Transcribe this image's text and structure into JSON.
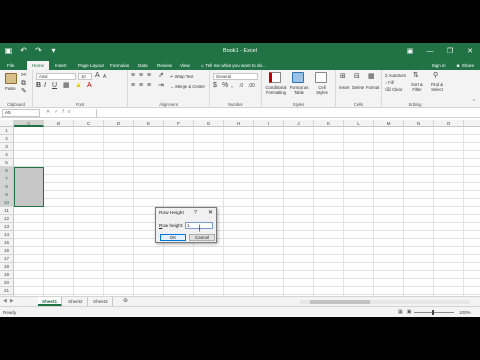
{
  "window": {
    "title": "Book1 - Excel",
    "qat_icons": [
      "save-icon",
      "undo-icon",
      "redo-icon",
      "customize-icon"
    ],
    "controls": [
      "minimize-icon",
      "restore-icon",
      "close-icon"
    ]
  },
  "ribbon_tabs": [
    "File",
    "Home",
    "Insert",
    "Page Layout",
    "Formulas",
    "Data",
    "Review",
    "View"
  ],
  "tell_me": "Tell me what you want to do...",
  "signin": "Sign in",
  "share": "Share",
  "ribbon": {
    "clipboard": {
      "paste": "Paste",
      "label": "Clipboard"
    },
    "font": {
      "name": "Arial",
      "size": "10",
      "label": "Font"
    },
    "alignment": {
      "wrap": "Wrap Text",
      "merge": "Merge & Center",
      "label": "Alignment"
    },
    "number": {
      "format": "General",
      "label": "Number"
    },
    "styles": {
      "conditional": "Conditional Formatting",
      "format_table": "Format as Table",
      "cell_styles": "Cell Styles",
      "label": "Styles"
    },
    "cells": {
      "insert": "Insert",
      "delete": "Delete",
      "format": "Format",
      "label": "Cells"
    },
    "editing": {
      "autosum": "AutoSum",
      "fill": "Fill",
      "clear": "Clear",
      "sort": "Sort & Filter",
      "find": "Find & Select",
      "label": "Editing"
    }
  },
  "formula_bar": {
    "name_box": "A5",
    "fx": "fx"
  },
  "columns": [
    "A",
    "B",
    "C",
    "D",
    "E",
    "F",
    "G",
    "H",
    "I",
    "J",
    "K",
    "L",
    "M",
    "N",
    "O"
  ],
  "rows": [
    "1",
    "2",
    "3",
    "4",
    "5",
    "6",
    "7",
    "8",
    "9",
    "10",
    "11",
    "12",
    "13",
    "14",
    "15",
    "16",
    "17",
    "18",
    "19",
    "20",
    "21",
    "22"
  ],
  "selected_column": "A",
  "selected_rows": [
    "6",
    "7",
    "8",
    "9",
    "10"
  ],
  "dialog": {
    "title": "Row Height",
    "help": "?",
    "label_prefix": "R",
    "label_rest": "ow height:",
    "value": "1",
    "ok": "OK",
    "cancel": "Cancel"
  },
  "sheets": [
    "Sheet1",
    "Sheet2",
    "Sheet3"
  ],
  "active_sheet": "Sheet1",
  "status": {
    "ready": "Ready",
    "zoom": "100%"
  },
  "colors": {
    "excel_green": "#217346",
    "ribbon_bg": "#f3f3f3"
  }
}
